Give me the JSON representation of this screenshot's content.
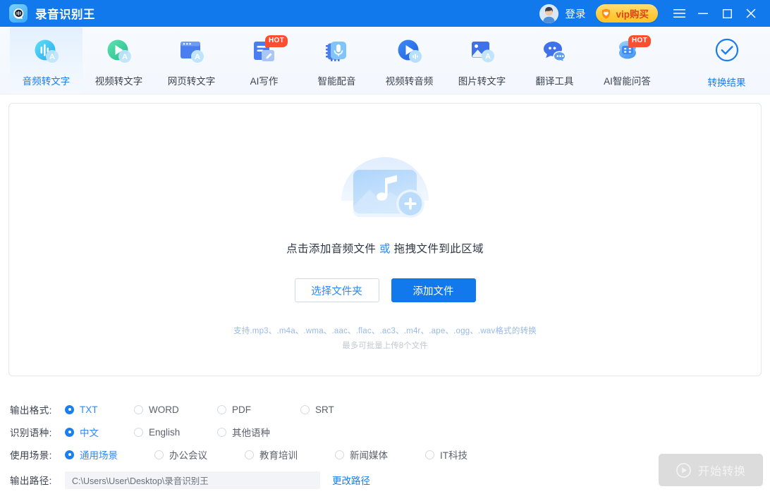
{
  "titlebar": {
    "app_title": "录音识别王",
    "logo_icon": "app-logo-icon",
    "avatar_icon": "user-avatar",
    "login_label": "登录",
    "vip_label": "vip购买",
    "vip_icon": "heart-shield-icon",
    "menu_icon": "hamburger-menu-icon",
    "minimize_icon": "minimize-icon",
    "maximize_icon": "maximize-icon",
    "close_icon": "close-icon",
    "bg_color": "#1179ec",
    "vip_bg_color": "#ffcb3d",
    "vip_text_color": "#d8441a"
  },
  "nav": {
    "items": [
      {
        "label": "音频转文字",
        "icon": "audio-to-text-icon",
        "active": true,
        "badge": ""
      },
      {
        "label": "视频转文字",
        "icon": "video-to-text-icon",
        "active": false,
        "badge": ""
      },
      {
        "label": "网页转文字",
        "icon": "webpage-to-text-icon",
        "active": false,
        "badge": ""
      },
      {
        "label": "AI写作",
        "icon": "ai-writing-icon",
        "active": false,
        "badge": "HOT"
      },
      {
        "label": "智能配音",
        "icon": "smart-dubbing-icon",
        "active": false,
        "badge": ""
      },
      {
        "label": "视频转音频",
        "icon": "video-to-audio-icon",
        "active": false,
        "badge": ""
      },
      {
        "label": "图片转文字",
        "icon": "image-to-text-icon",
        "active": false,
        "badge": ""
      },
      {
        "label": "翻译工具",
        "icon": "translate-tool-icon",
        "active": false,
        "badge": ""
      },
      {
        "label": "AI智能问答",
        "icon": "ai-qa-icon",
        "active": false,
        "badge": "HOT"
      }
    ],
    "result_tab": {
      "label": "转换结果",
      "icon": "check-circle-icon"
    },
    "active_text_color": "#1a7cf0",
    "badge_color": "#fb5030"
  },
  "dropzone": {
    "art_icon": "add-audio-file-icon",
    "prompt_prefix": "点击添加音频文件",
    "prompt_middle": "或",
    "prompt_suffix": "拖拽文件到此区域",
    "select_folder_label": "选择文件夹",
    "add_file_label": "添加文件",
    "supported_formats": "支持.mp3、.m4a、.wma、.aac、.flac、.ac3、.m4r、.ape、.ogg、.wav格式的转换",
    "batch_limit": "最多可批量上传8个文件",
    "primary_btn_color": "#1179ec"
  },
  "settings": {
    "output_format": {
      "label": "输出格式:",
      "options": [
        {
          "label": "TXT",
          "selected": true
        },
        {
          "label": "WORD",
          "selected": false
        },
        {
          "label": "PDF",
          "selected": false
        },
        {
          "label": "SRT",
          "selected": false
        }
      ]
    },
    "language": {
      "label": "识别语种:",
      "options": [
        {
          "label": "中文",
          "selected": true
        },
        {
          "label": "English",
          "selected": false
        },
        {
          "label": "其他语种",
          "selected": false
        }
      ]
    },
    "scene": {
      "label": "使用场景:",
      "options": [
        {
          "label": "通用场景",
          "selected": true
        },
        {
          "label": "办公会议",
          "selected": false
        },
        {
          "label": "教育培训",
          "selected": false
        },
        {
          "label": "新闻媒体",
          "selected": false
        },
        {
          "label": "IT科技",
          "selected": false
        }
      ]
    },
    "output_path": {
      "label": "输出路径:",
      "value": "C:\\Users\\User\\Desktop\\录音识别王",
      "change_label": "更改路径"
    },
    "start_button": {
      "label": "开始转换",
      "icon": "play-circle-icon",
      "disabled": true,
      "bg_color": "#dcdcdc"
    },
    "selected_color": "#2f88f4"
  }
}
